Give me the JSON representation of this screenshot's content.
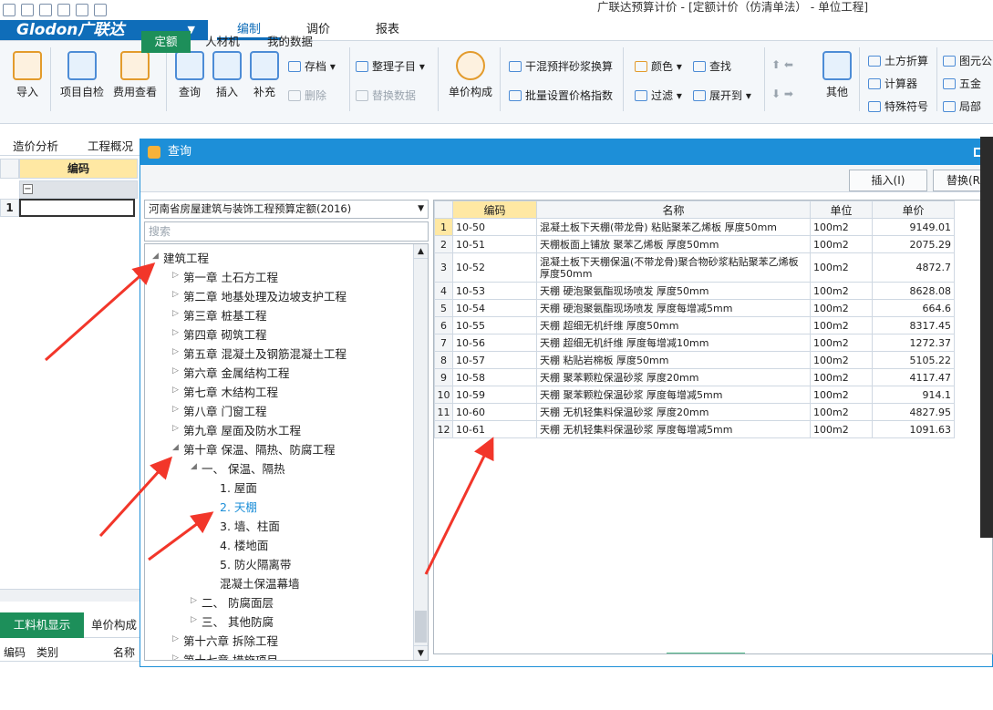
{
  "window": {
    "title": "广联达预算计价 - [定额计价（仿清单法） - 单位工程]"
  },
  "logo": {
    "text": "Glodon广联达"
  },
  "menu": {
    "tabs": [
      {
        "label": "编制"
      },
      {
        "label": "调价"
      },
      {
        "label": "报表"
      }
    ]
  },
  "ribbon": {
    "import": "导入",
    "self_check": "项目自检",
    "fee_check": "费用查看",
    "query": "查询",
    "insert": "插入",
    "supplement": "补充",
    "save_as": "存档",
    "delete": "删除",
    "arrange": "整理子目",
    "replace_data": "替换数据",
    "unit_price": "单价构成",
    "dry_mix": "干混预拌砂浆换算",
    "batch_price": "批量设置价格指数",
    "color": "颜色",
    "find": "查找",
    "filter": "过滤",
    "expand": "展开到",
    "other": "其他",
    "earth_calc": "土方折算",
    "calculator": "计算器",
    "special_symbol": "特殊符号",
    "formula": "图元公",
    "wujin": "五金",
    "partial": "局部"
  },
  "subtabs": [
    {
      "label": "造价分析"
    },
    {
      "label": "工程概况"
    }
  ],
  "left_grid": {
    "header": "编码",
    "row_num": "1"
  },
  "bottom_panel": {
    "tab_active": "工料机显示",
    "tab_other": "单价构成",
    "cols": [
      "编码",
      "类别",
      "名称"
    ]
  },
  "dialog": {
    "title": "查询",
    "tabs": [
      {
        "label": "定额"
      },
      {
        "label": "人材机"
      },
      {
        "label": "我的数据"
      }
    ],
    "insert_btn": "插入(I)",
    "replace_btn": "替换(R",
    "quota_select": "河南省房屋建筑与装饰工程预算定额(2016)",
    "search_placeholder": "搜索",
    "tree": [
      {
        "label": "建筑工程"
      },
      {
        "label": "第一章  土石方工程"
      },
      {
        "label": "第二章  地基处理及边坡支护工程"
      },
      {
        "label": "第三章  桩基工程"
      },
      {
        "label": "第四章  砌筑工程"
      },
      {
        "label": "第五章  混凝土及钢筋混凝土工程"
      },
      {
        "label": "第六章  金属结构工程"
      },
      {
        "label": "第七章  木结构工程"
      },
      {
        "label": "第八章  门窗工程"
      },
      {
        "label": "第九章  屋面及防水工程"
      },
      {
        "label": "第十章  保温、隔热、防腐工程"
      },
      {
        "label": "一、  保温、隔热"
      },
      {
        "label": "1.  屋面"
      },
      {
        "label": "2.  天棚"
      },
      {
        "label": "3.  墙、柱面"
      },
      {
        "label": "4.  楼地面"
      },
      {
        "label": "5.  防火隔离带"
      },
      {
        "label": "混凝土保温幕墙"
      },
      {
        "label": "二、  防腐面层"
      },
      {
        "label": "三、  其他防腐"
      },
      {
        "label": "第十六章  拆除工程"
      },
      {
        "label": "第十七章  措施项目"
      }
    ],
    "grid": {
      "headers": [
        "编码",
        "名称",
        "单位",
        "单价"
      ],
      "rows": [
        {
          "n": "1",
          "code": "10-50",
          "name": "混凝土板下天棚(带龙骨) 粘贴聚苯乙烯板 厚度50mm",
          "unit": "100m2",
          "price": "9149.01"
        },
        {
          "n": "2",
          "code": "10-51",
          "name": "天棚板面上铺放 聚苯乙烯板 厚度50mm",
          "unit": "100m2",
          "price": "2075.29"
        },
        {
          "n": "3",
          "code": "10-52",
          "name": "混凝土板下天棚保温(不带龙骨)聚合物砂浆粘贴聚苯乙烯板 厚度50mm",
          "unit": "100m2",
          "price": "4872.7"
        },
        {
          "n": "4",
          "code": "10-53",
          "name": "天棚 硬泡聚氨酯现场喷发 厚度50mm",
          "unit": "100m2",
          "price": "8628.08"
        },
        {
          "n": "5",
          "code": "10-54",
          "name": "天棚 硬泡聚氨酯现场喷发 厚度每增减5mm",
          "unit": "100m2",
          "price": "664.6"
        },
        {
          "n": "6",
          "code": "10-55",
          "name": "天棚 超细无机纤维 厚度50mm",
          "unit": "100m2",
          "price": "8317.45"
        },
        {
          "n": "7",
          "code": "10-56",
          "name": "天棚 超细无机纤维 厚度每增减10mm",
          "unit": "100m2",
          "price": "1272.37"
        },
        {
          "n": "8",
          "code": "10-57",
          "name": "天棚 粘贴岩棉板 厚度50mm",
          "unit": "100m2",
          "price": "5105.22"
        },
        {
          "n": "9",
          "code": "10-58",
          "name": "天棚 聚苯颗粒保温砂浆 厚度20mm",
          "unit": "100m2",
          "price": "4117.47"
        },
        {
          "n": "10",
          "code": "10-59",
          "name": "天棚 聚苯颗粒保温砂浆 厚度每增减5mm",
          "unit": "100m2",
          "price": "914.1"
        },
        {
          "n": "11",
          "code": "10-60",
          "name": "天棚 无机轻集料保温砂浆 厚度20mm",
          "unit": "100m2",
          "price": "4827.95"
        },
        {
          "n": "12",
          "code": "10-61",
          "name": "天棚 无机轻集料保温砂浆 厚度每增减5mm",
          "unit": "100m2",
          "price": "1091.63"
        }
      ]
    }
  },
  "colors": {
    "brand": "#0f6db9",
    "dialog_header": "#1d8fd8",
    "active_green": "#1d8f5a",
    "annotation_arrow": "#f2362a"
  }
}
